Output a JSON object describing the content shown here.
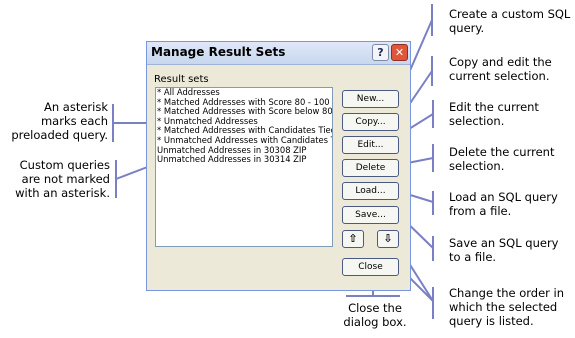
{
  "dialog": {
    "title": "Manage Result Sets",
    "help_glyph": "?",
    "close_glyph": "✕",
    "list_label": "Result sets",
    "result_sets": [
      "* All Addresses",
      "* Matched Addresses with Score 80 - 100",
      "* Matched Addresses with Score below 80",
      "* Unmatched Addresses",
      "* Matched Addresses with Candidates Tied",
      "* Unmatched Addresses with Candidates Tied",
      "Unmatched Addresses in 30308 ZIP",
      "Unmatched Addresses in 30314 ZIP"
    ],
    "buttons": {
      "new": "New...",
      "copy": "Copy...",
      "edit": "Edit...",
      "delete": "Delete",
      "load": "Load...",
      "save": "Save...",
      "move_up": "⇧",
      "move_down": "⇩",
      "close": "Close"
    }
  },
  "callouts": {
    "new": "Create a custom SQL query.",
    "copy": "Copy and edit the current selection.",
    "edit": "Edit the current selection.",
    "delete": "Delete the current selection.",
    "load": "Load an SQL query from a file.",
    "save": "Save an SQL query to a file.",
    "order": "Change the order in which the selected query is listed.",
    "close": "Close the dialog box.",
    "asterisk": "An asterisk marks each preloaded query.",
    "custom": "Custom queries are not marked with an asterisk."
  },
  "colors": {
    "callout_line": "#7b7fc4",
    "dialog_bg": "#ece9d8"
  }
}
